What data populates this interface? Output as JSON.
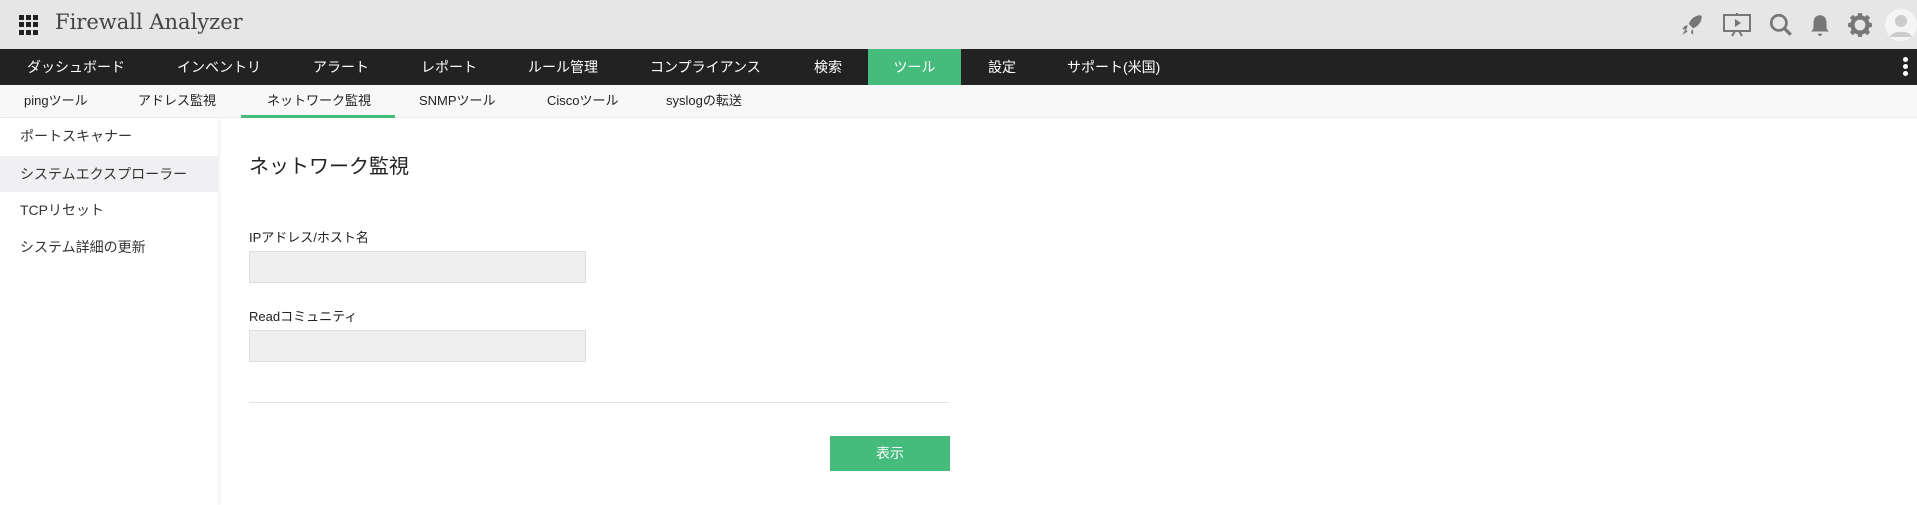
{
  "header": {
    "app_title": "Firewall Analyzer"
  },
  "nav": {
    "items": [
      "ダッシュボード",
      "インベントリ",
      "アラート",
      "レポート",
      "ルール管理",
      "コンプライアンス",
      "検索",
      "ツール",
      "設定",
      "サポート(米国)"
    ],
    "active": "ツール"
  },
  "subnav": {
    "items": [
      "pingツール",
      "アドレス監視",
      "ネットワーク監視",
      "SNMPツール",
      "Ciscoツール",
      "syslogの転送"
    ],
    "active": "ネットワーク監視"
  },
  "sidebar": {
    "items": [
      "ポートスキャナー",
      "システムエクスプローラー",
      "TCPリセット",
      "システム詳細の更新"
    ],
    "active": "システムエクスプローラー"
  },
  "main": {
    "title": "ネットワーク監視",
    "ip_label": "IPアドレス/ホスト名",
    "ip_value": "",
    "community_label": "Readコミュニティ",
    "community_value": "",
    "submit_label": "表示"
  },
  "colors": {
    "accent": "#45bb7c",
    "nav_bg": "#222222",
    "header_bg": "#e6e6e6"
  }
}
